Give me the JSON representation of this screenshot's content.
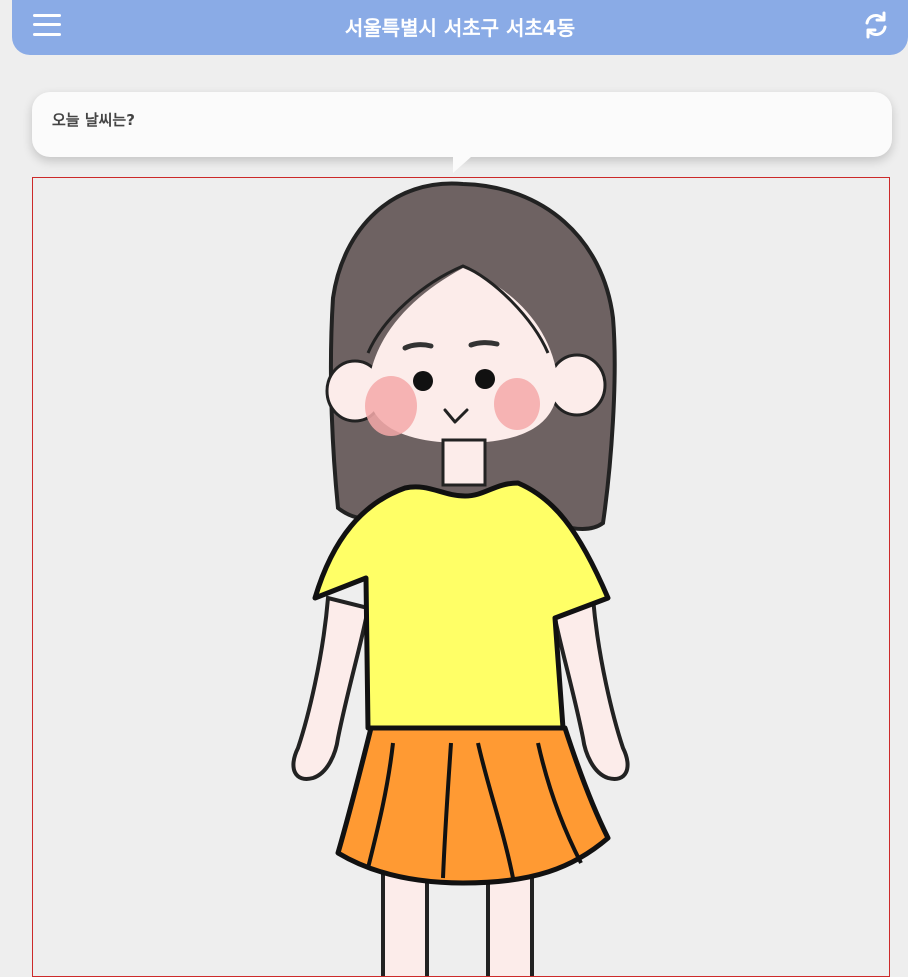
{
  "header": {
    "location": "서울특별시 서초구 서초4동",
    "menu_icon": "hamburger-menu-icon",
    "refresh_icon": "refresh-icon",
    "bg_color": "#8aabe6"
  },
  "bubble": {
    "question": "오늘 날씨는?"
  },
  "character": {
    "hair_color": "#6e6262",
    "skin_color": "#fcecea",
    "shirt_color": "#ffff66",
    "skirt_color": "#ff9a33",
    "cheek_color": "#f4a9a9"
  },
  "canvas": {
    "border_color": "#cc2a2a"
  }
}
